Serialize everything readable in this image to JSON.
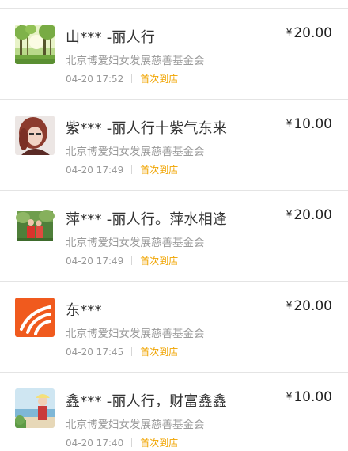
{
  "donations": [
    {
      "name": "山*** -丽人行",
      "currency": "¥",
      "amount": "20.00",
      "org": "北京博爱妇女发展慈善基金会",
      "time": "04-20 17:52",
      "tag": "首次到店",
      "avatar_icon": "forest-photo-avatar"
    },
    {
      "name": "紫*** -丽人行十紫气东来",
      "currency": "¥",
      "amount": "10.00",
      "org": "北京博爱妇女发展慈善基金会",
      "time": "04-20 17:49",
      "tag": "首次到店",
      "avatar_icon": "woman-portrait-avatar"
    },
    {
      "name": "萍*** -丽人行。萍水相逢",
      "currency": "¥",
      "amount": "20.00",
      "org": "北京博爱妇女发展慈善基金会",
      "time": "04-20 17:49",
      "tag": "首次到店",
      "avatar_icon": "couple-photo-avatar"
    },
    {
      "name": "东***",
      "currency": "¥",
      "amount": "20.00",
      "org": "北京博爱妇女发展慈善基金会",
      "time": "04-20 17:45",
      "tag": "首次到店",
      "avatar_icon": "orange-logo-avatar"
    },
    {
      "name": "鑫*** -丽人行，财富鑫鑫",
      "currency": "¥",
      "amount": "10.00",
      "org": "北京博爱妇女发展慈善基金会",
      "time": "04-20 17:40",
      "tag": "首次到店",
      "avatar_icon": "beach-photo-avatar"
    }
  ]
}
